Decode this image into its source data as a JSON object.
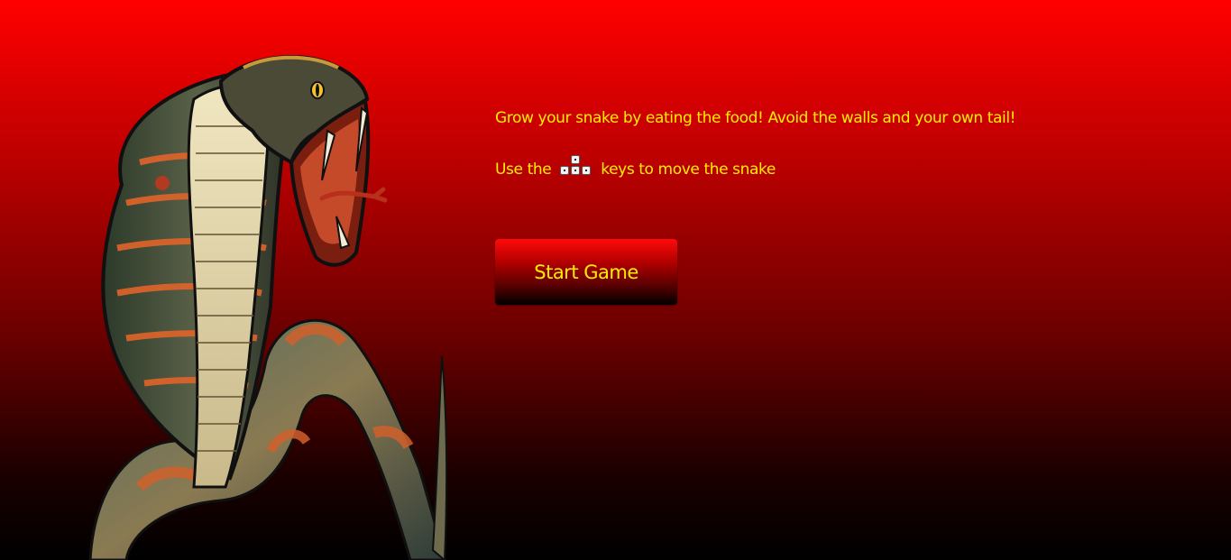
{
  "game": {
    "instructions": {
      "line1": "Grow your snake by eating the food! Avoid the walls and your own tail!",
      "line2_prefix": "Use the",
      "line2_suffix": "keys to move the snake"
    },
    "start_button_label": "Start Game"
  },
  "icons": {
    "hero": "cobra-illustration",
    "keys": "arrow-keys-icon"
  },
  "colors": {
    "text": "#ffee00",
    "background_top": "#ff0000",
    "background_bottom": "#000000"
  }
}
